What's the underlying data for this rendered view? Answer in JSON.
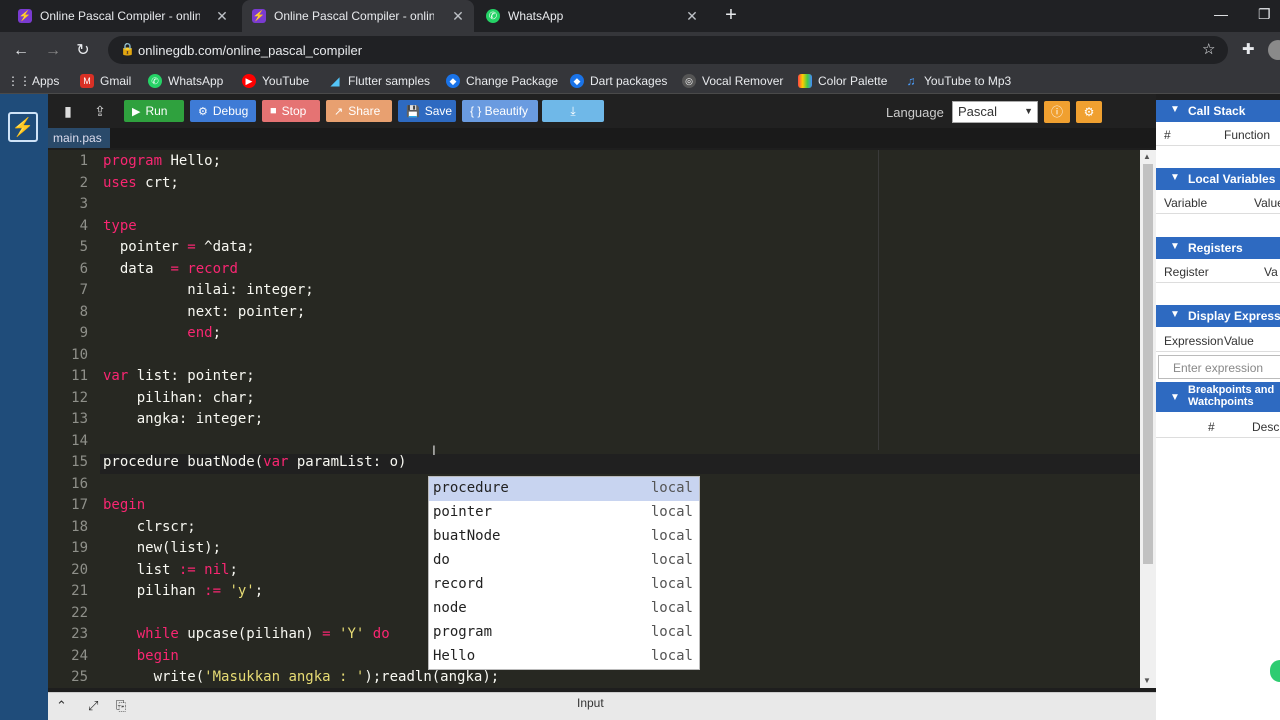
{
  "browser": {
    "tabs": [
      {
        "title": "Online Pascal Compiler - online e",
        "active": false,
        "icon_color": "#7a3bd0"
      },
      {
        "title": "Online Pascal Compiler - online e",
        "active": true,
        "icon_color": "#7a3bd0"
      },
      {
        "title": "WhatsApp",
        "active": false,
        "icon_color": "#25d366"
      }
    ],
    "url": "onlinegdb.com/online_pascal_compiler",
    "bookmarks": [
      "Apps",
      "Gmail",
      "WhatsApp",
      "YouTube",
      "Flutter samples",
      "Change Package",
      "Dart packages",
      "Vocal Remover",
      "Color Palette",
      "YouTube to Mp3"
    ]
  },
  "toolbar": {
    "run": "Run",
    "debug": "Debug",
    "stop": "Stop",
    "share": "Share",
    "save": "Save",
    "beautify": "{ } Beautify",
    "language_label": "Language",
    "language_value": "Pascal"
  },
  "file_tab": "main.pas",
  "editor": {
    "line_numbers": [
      "1",
      "2",
      "3",
      "4",
      "5",
      "6",
      "7",
      "8",
      "9",
      "10",
      "11",
      "12",
      "13",
      "14",
      "15",
      "16",
      "17",
      "18",
      "19",
      "20",
      "21",
      "22",
      "23",
      "24",
      "25"
    ]
  },
  "autocomplete": {
    "items": [
      {
        "word": "procedure",
        "meta": "local"
      },
      {
        "word": "pointer",
        "meta": "local"
      },
      {
        "word": "buatNode",
        "meta": "local"
      },
      {
        "word": "do",
        "meta": "local"
      },
      {
        "word": "record",
        "meta": "local"
      },
      {
        "word": "node",
        "meta": "local"
      },
      {
        "word": "program",
        "meta": "local"
      },
      {
        "word": "Hello",
        "meta": "local"
      }
    ]
  },
  "bottom": {
    "input_label": "Input"
  },
  "right_panel": {
    "call_stack": {
      "title": "Call Stack",
      "col1": "#",
      "col2": "Function"
    },
    "local_vars": {
      "title": "Local Variables",
      "col1": "Variable",
      "col2": "Value"
    },
    "registers": {
      "title": "Registers",
      "col1": "Register",
      "col2": "Va"
    },
    "display_expr": {
      "title": "Display Expressions",
      "col1": "Expression",
      "col2": "Value",
      "placeholder": "Enter expression"
    },
    "breakpoints": {
      "title": "Breakpoints and Watchpoints",
      "col1": "#",
      "col2": "Desc"
    }
  }
}
